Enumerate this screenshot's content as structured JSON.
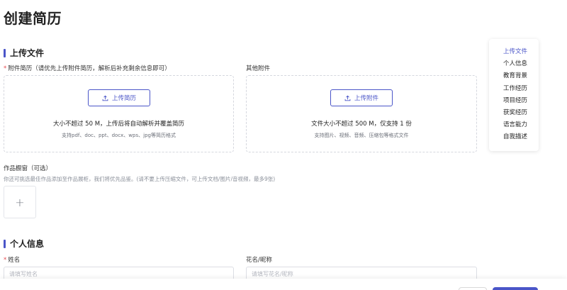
{
  "page": {
    "title": "创建简历"
  },
  "sections": {
    "upload": {
      "title": "上传文件"
    },
    "personal": {
      "title": "个人信息"
    }
  },
  "resume_upload": {
    "label": "附件简历（请优先上传附件简历，解析后补充剩余信息即可）",
    "button": "上传简历",
    "main_text": "大小不超过 50 M，上传后将自动解析并覆盖简历",
    "sub_text": "支持pdf、doc、ppt、docx、wps、jpg等简历格式"
  },
  "other_upload": {
    "label": "其他附件",
    "button": "上传附件",
    "main_text": "文件大小不超过 500 M，仅支持 1 份",
    "sub_text": "支持图片、视频、音频、压缩包等格式文件"
  },
  "portfolio": {
    "label": "作品橱窗（可选）",
    "hint": "你还可挑选最佳作品添加至作品展柜，我们将优先品鉴。(请不要上传压缩文件，可上传文档/图片/音视频，最多9张)",
    "add_symbol": "+"
  },
  "personal_fields": {
    "name_label": "姓名",
    "name_placeholder": "请填写姓名",
    "nickname_label": "花名/昵称",
    "nickname_placeholder": "请填写花名/昵称"
  },
  "anchor_nav": {
    "items": [
      {
        "label": "上传文件",
        "active": true
      },
      {
        "label": "个人信息"
      },
      {
        "label": "教育背景"
      },
      {
        "label": "工作经历"
      },
      {
        "label": "项目经历"
      },
      {
        "label": "获奖经历"
      },
      {
        "label": "语言能力"
      },
      {
        "label": "自我描述"
      }
    ]
  },
  "colors": {
    "accent": "#4a55c8",
    "required": "#e5484d"
  },
  "icons": {
    "upload": "upload-icon",
    "plus": "plus-icon"
  }
}
